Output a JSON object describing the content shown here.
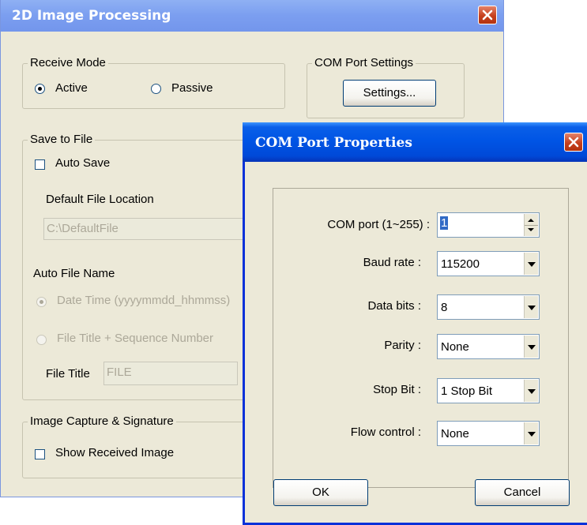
{
  "main_window": {
    "title": "2D Image Processing",
    "receive_mode": {
      "label": "Receive Mode",
      "active": "Active",
      "passive": "Passive",
      "selected": "Active"
    },
    "com_port_settings": {
      "label": "COM Port Settings",
      "button": "Settings..."
    },
    "save_to_file": {
      "label": "Save to File",
      "auto_save": "Auto Save",
      "auto_save_checked": false,
      "default_file_location_label": "Default File Location",
      "default_file_location_value": "C:\\DefaultFile",
      "auto_file_name_label": "Auto File Name",
      "date_time_option": "Date Time (yyyymmdd_hhmmss)",
      "file_title_option": "File Title + Sequence Number",
      "file_title_label": "File Title",
      "file_title_value": "FILE"
    },
    "image_capture": {
      "label": "Image Capture & Signature",
      "show_received_image": "Show Received Image",
      "checked": false
    }
  },
  "com_dialog": {
    "title": "COM Port Properties",
    "fields": {
      "com_port": {
        "label": "COM port (1~255) :",
        "value": "1"
      },
      "baud_rate": {
        "label": "Baud rate :",
        "value": "115200"
      },
      "data_bits": {
        "label": "Data bits :",
        "value": "8"
      },
      "parity": {
        "label": "Parity :",
        "value": "None"
      },
      "stop_bit": {
        "label": "Stop Bit :",
        "value": "1 Stop Bit"
      },
      "flow_control": {
        "label": "Flow control :",
        "value": "None"
      }
    },
    "ok": "OK",
    "cancel": "Cancel"
  },
  "colors": {
    "titlebar": "#0a58ea",
    "close": "#c6401e",
    "face": "#ece9d8"
  }
}
